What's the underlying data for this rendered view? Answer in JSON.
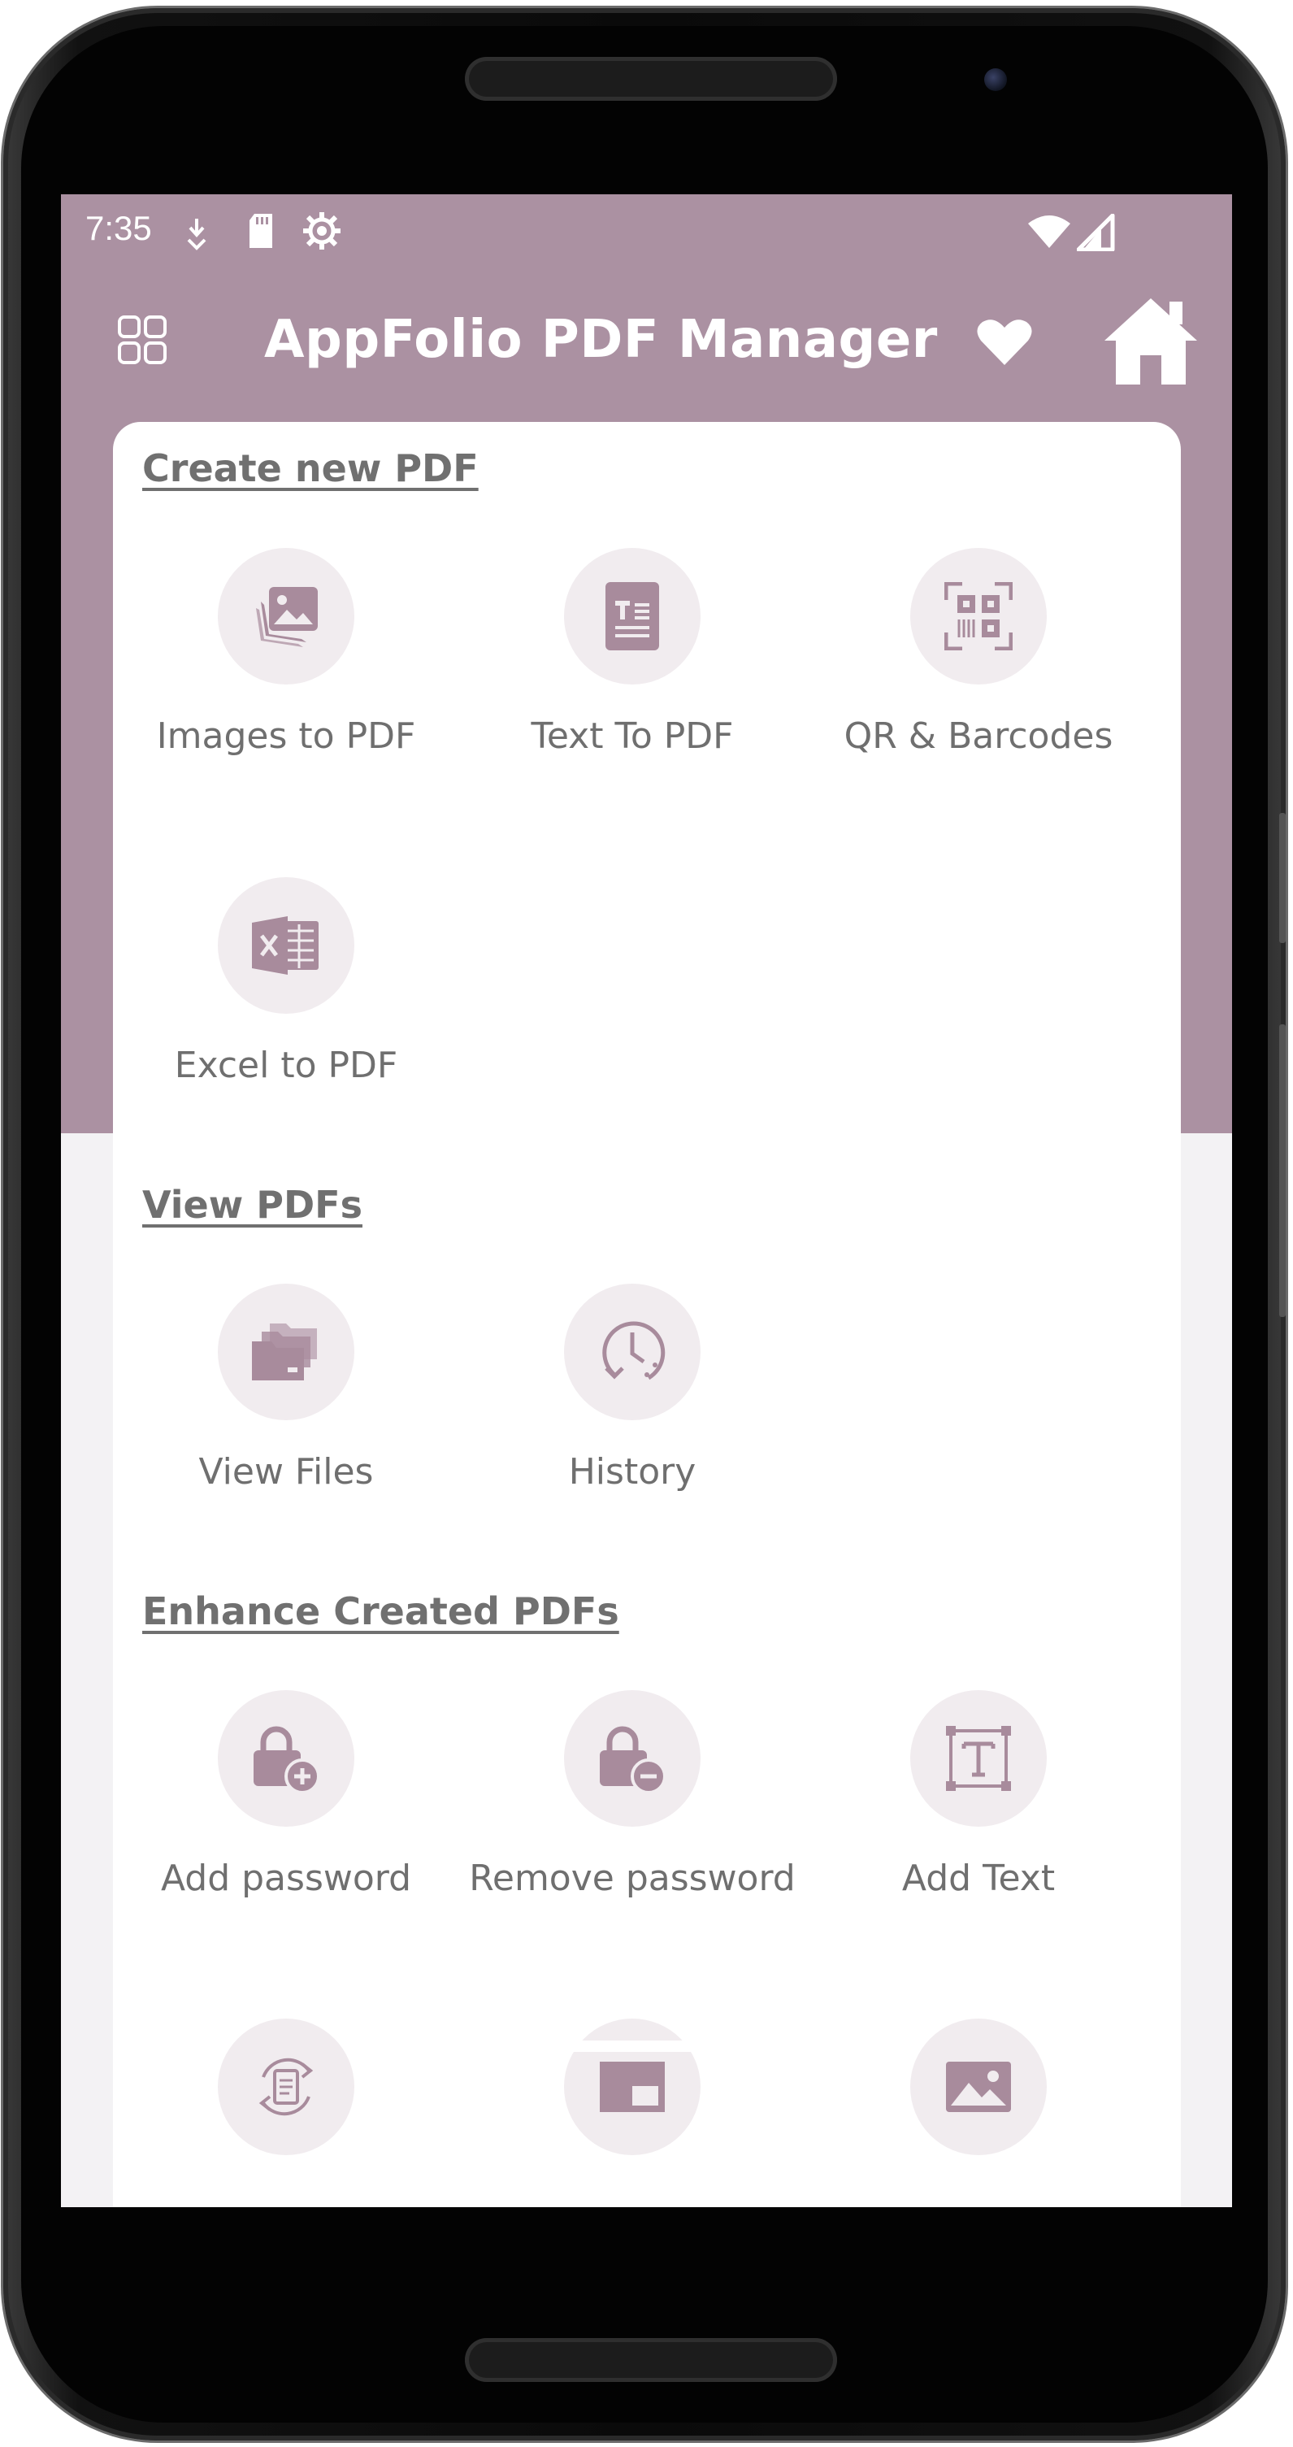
{
  "status_bar": {
    "time": "7:35"
  },
  "app_bar": {
    "title": "AppFolio PDF Manager",
    "menu_icon": "grid-menu-icon",
    "favorite_icon": "heart-icon",
    "home_icon": "home-icon"
  },
  "sections": {
    "create": {
      "title": "Create new PDF",
      "items": [
        {
          "label": "Images to PDF",
          "icon": "images-icon"
        },
        {
          "label": "Text To PDF",
          "icon": "text-document-icon"
        },
        {
          "label": "QR & Barcodes",
          "icon": "qr-barcode-icon"
        },
        {
          "label": "Excel to PDF",
          "icon": "excel-icon"
        }
      ]
    },
    "view": {
      "title": "View PDFs",
      "items": [
        {
          "label": "View Files",
          "icon": "folders-icon"
        },
        {
          "label": "History",
          "icon": "history-icon"
        }
      ]
    },
    "enhance": {
      "title": "Enhance Created PDFs",
      "items": [
        {
          "label": "Add password",
          "icon": "lock-add-icon"
        },
        {
          "label": "Remove password",
          "icon": "lock-remove-icon"
        },
        {
          "label": "Add Text",
          "icon": "add-text-icon"
        },
        {
          "label": "",
          "icon": "rotate-document-icon"
        },
        {
          "label": "",
          "icon": "picture-in-picture-icon"
        },
        {
          "label": "",
          "icon": "image-icon"
        }
      ]
    }
  },
  "colors": {
    "primary": "#ab91a2",
    "icon": "#a88b9c",
    "icon_bg": "#f1ecef",
    "text": "#6f6f6f"
  }
}
